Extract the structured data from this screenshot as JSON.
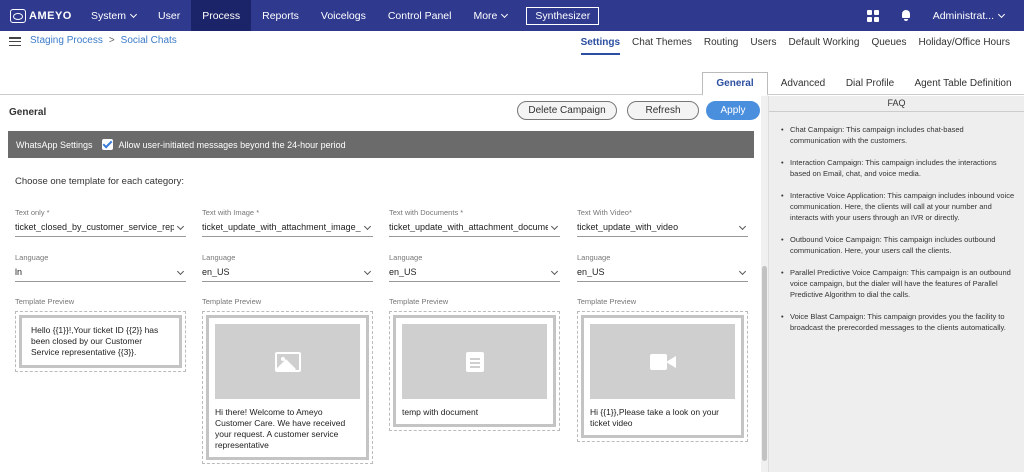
{
  "brand": {
    "logo_text": "AMEYO"
  },
  "nav": {
    "items": [
      {
        "label": "System",
        "caret": true,
        "active": false
      },
      {
        "label": "User",
        "caret": false,
        "active": false
      },
      {
        "label": "Process",
        "caret": false,
        "active": true
      },
      {
        "label": "Reports",
        "caret": false,
        "active": false
      },
      {
        "label": "Voicelogs",
        "caret": false,
        "active": false
      },
      {
        "label": "Control Panel",
        "caret": false,
        "active": false
      },
      {
        "label": "More",
        "caret": true,
        "active": false
      }
    ],
    "synthesizer": "Synthesizer",
    "user": "Administrat..."
  },
  "breadcrumb": {
    "first": "Staging Process",
    "separator": ">",
    "second": "Social Chats"
  },
  "top_tabs": [
    "Settings",
    "Chat Themes",
    "Routing",
    "Users",
    "Default Working",
    "Queues",
    "Holiday/Office Hours"
  ],
  "sub_tabs": [
    "General",
    "Advanced",
    "Dial Profile",
    "Agent Table Definition"
  ],
  "general": {
    "title": "General",
    "delete_label": "Delete Campaign",
    "refresh_label": "Refresh",
    "apply_label": "Apply",
    "whatsapp_label": "WhatsApp Settings",
    "allow_label": "Allow user-initiated messages beyond the 24-hour period",
    "choose_label": "Choose one template for each category:",
    "language_label": "Language",
    "preview_label": "Template Preview"
  },
  "templates": [
    {
      "label": "Text only *",
      "value": "ticket_closed_by_customer_service_rep...",
      "language": "ln",
      "media": "none",
      "preview": "Hello {{1}}!,Your ticket ID {{2}} has been closed by our Customer Service representative {{3}}."
    },
    {
      "label": "Text with Image *",
      "value": "ticket_update_with_attachment_image_...",
      "language": "en_US",
      "media": "image-icon",
      "preview": "Hi there! Welcome to Ameyo Customer Care. We have received your request. A customer service representative"
    },
    {
      "label": "Text with Documents *",
      "value": "ticket_update_with_attachment_docume...",
      "language": "en_US",
      "media": "document-icon",
      "preview": "temp with document"
    },
    {
      "label": "Text With Video*",
      "value": "ticket_update_with_video",
      "language": "en_US",
      "media": "video-icon",
      "preview": "Hi {{1}},Please take a look on your ticket video"
    }
  ],
  "faq": {
    "title": "FAQ",
    "items": [
      "Chat Campaign: This campaign includes chat-based communication with the customers.",
      "Interaction Campaign: This campaign includes the interactions based on Email, chat, and voice media.",
      "Interactive Voice Application: This campaign includes inbound voice communication. Here, the clients will call at your number and interacts with your users through an IVR or directly.",
      "Outbound Voice Campaign: This campaign includes outbound communication. Here, your users call the clients.",
      "Parallel Predictive Voice Campaign: This campaign is an outbound voice campaign, but the dialer will have the features of Parallel Predictive Algorithm to dial the calls.",
      "Voice Blast Campaign: This campaign provides you the facility to broadcast the prerecorded messages to the clients automatically."
    ]
  },
  "colors": {
    "nav_bg": "#2f3a8f",
    "nav_active": "#1c2469",
    "accent": "#4a8fdd",
    "link": "#3d7cc9"
  }
}
